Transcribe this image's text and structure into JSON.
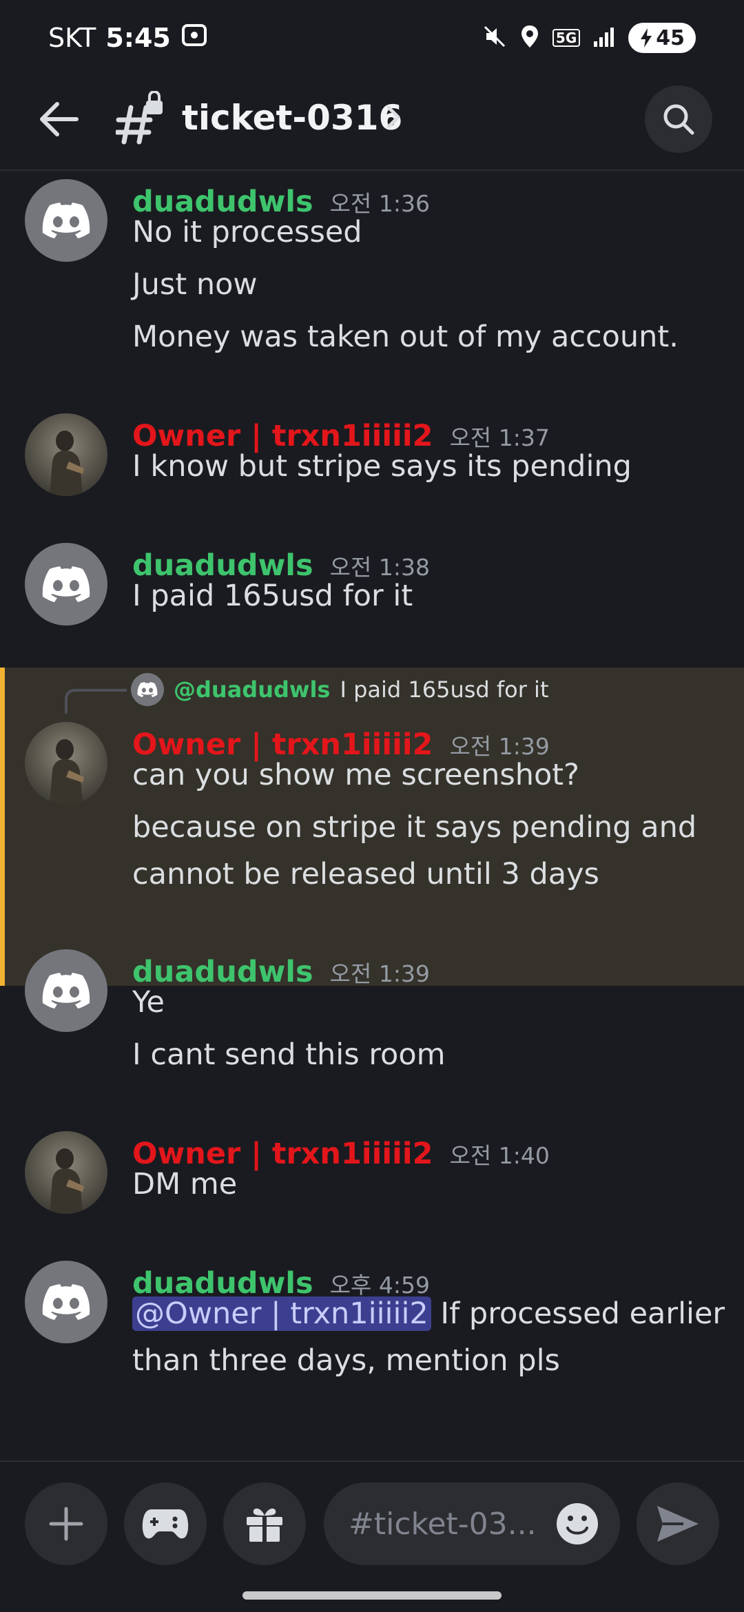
{
  "status_bar": {
    "carrier": "SKT",
    "time": "5:45",
    "network": "5G",
    "battery": "45"
  },
  "header": {
    "channel_name": "ticket-0316"
  },
  "messages": [
    {
      "author": "duadudwls",
      "timestamp": "오전 1:36",
      "lines": [
        "No it processed",
        "Just now",
        "Money was taken out of my account."
      ]
    },
    {
      "author": "Owner | trxn1iiiii2",
      "timestamp": "오전 1:37",
      "lines": [
        "I know but stripe says its pending"
      ]
    },
    {
      "author": "duadudwls",
      "timestamp": "오전 1:38",
      "lines": [
        "I paid 165usd for it"
      ]
    },
    {
      "reply": {
        "mention": "@duadudwls",
        "text": "I paid 165usd for it"
      },
      "author": "Owner | trxn1iiiii2",
      "timestamp": "오전 1:39",
      "lines": [
        "can you show me screenshot?",
        "because on stripe it says pending and",
        "cannot be released until 3 days"
      ]
    },
    {
      "author": "duadudwls",
      "timestamp": "오전 1:39",
      "lines": [
        "Ye",
        "I cant send this room"
      ]
    },
    {
      "author": "Owner | trxn1iiiii2",
      "timestamp": "오전 1:40",
      "lines": [
        "DM me"
      ]
    },
    {
      "author": "duadudwls",
      "timestamp": "오후 4:59",
      "mention": "@Owner | trxn1iiiii2",
      "lines": [
        " If processed earlier",
        "than three days, mention pls"
      ]
    }
  ],
  "composer": {
    "placeholder": "#ticket-03..."
  },
  "colors": {
    "background": "#1a1b20",
    "user_green": "#3ec46d",
    "owner_red": "#e3161b",
    "highlight_bg": "#34322a",
    "highlight_bar": "#f0b232",
    "mention_bg": "#3c3f8f"
  }
}
